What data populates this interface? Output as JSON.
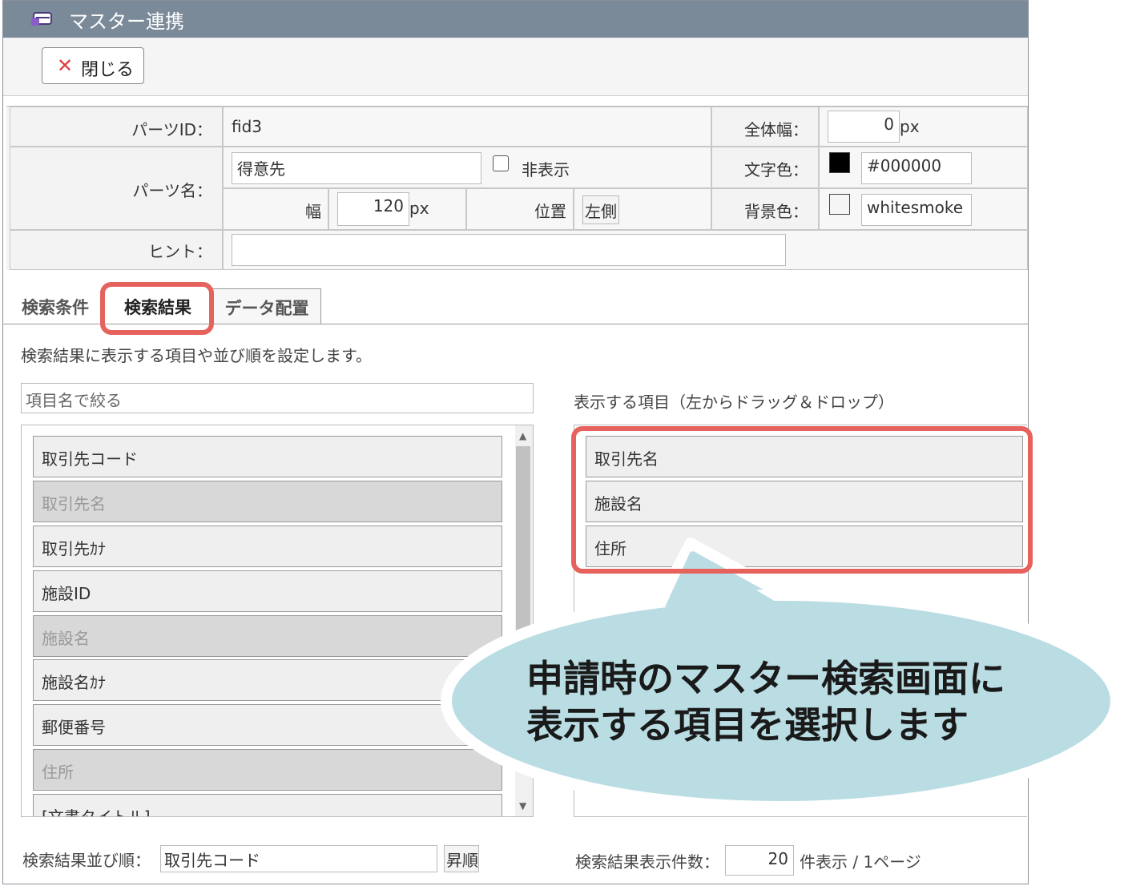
{
  "window": {
    "title": "マスター連携"
  },
  "toolbar": {
    "close_label": "閉じる"
  },
  "props": {
    "parts_id_label": "パーツID：",
    "parts_id_value": "fid3",
    "total_width_label": "全体幅：",
    "total_width_value": "0",
    "px": "px",
    "parts_name_label": "パーツ名：",
    "parts_name_value": "得意先",
    "hidden_label": "非表示",
    "text_color_label": "文字色：",
    "text_color_value": "#000000",
    "width_label": "幅",
    "width_value": "120",
    "position_label": "位置",
    "position_value": "左側",
    "bg_color_label": "背景色：",
    "bg_color_value": "whitesmoke",
    "hint_label": "ヒント：",
    "hint_value": ""
  },
  "tabs": [
    {
      "label": "検索条件"
    },
    {
      "label": "検索結果"
    },
    {
      "label": "データ配置"
    }
  ],
  "results": {
    "description": "検索結果に表示する項目や並び順を設定します。",
    "filter_placeholder": "項目名で絞る",
    "available_items": [
      {
        "label": "取引先コード",
        "disabled": false
      },
      {
        "label": "取引先名",
        "disabled": true
      },
      {
        "label": "取引先ｶﾅ",
        "disabled": false
      },
      {
        "label": "施設ID",
        "disabled": false
      },
      {
        "label": "施設名",
        "disabled": true
      },
      {
        "label": "施設名ｶﾅ",
        "disabled": false
      },
      {
        "label": "郵便番号",
        "disabled": false
      },
      {
        "label": "住所",
        "disabled": true
      },
      {
        "label": "[文書タイトル]",
        "disabled": false
      }
    ],
    "display_label": "表示する項目（左からドラッグ＆ドロップ）",
    "display_items": [
      "取引先名",
      "施設名",
      "住所"
    ],
    "sort_label": "検索結果並び順：",
    "sort_value": "取引先コード",
    "sort_order": "昇順",
    "count_label": "検索結果表示件数：",
    "count_value": "20",
    "count_suffix": "件表示 / 1ページ"
  },
  "callout": {
    "line1": "申請時のマスター検索画面に",
    "line2": "表示する項目を選択します"
  },
  "colors": {
    "titlebar": "#7b8a99",
    "highlight": "#e5625d",
    "callout": "#b9dde3",
    "close_x": "#e03c3c"
  }
}
